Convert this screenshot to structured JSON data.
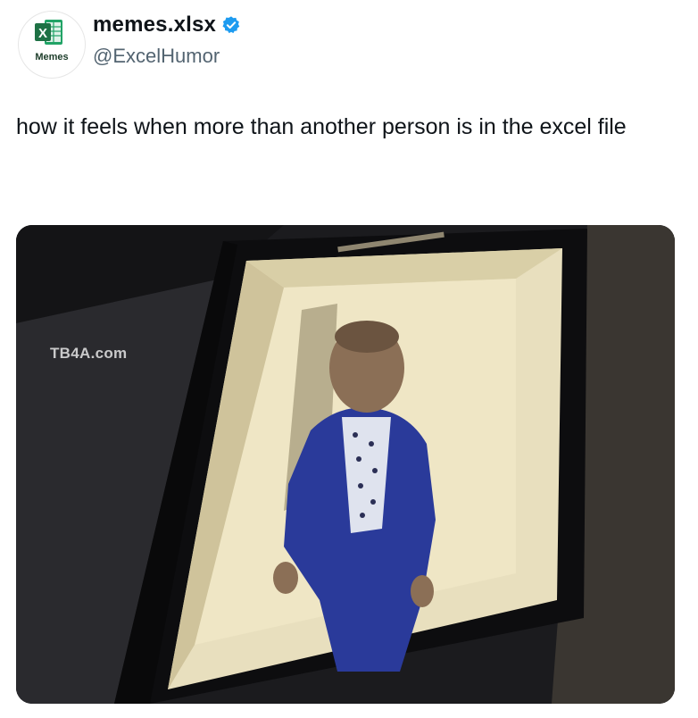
{
  "author": {
    "display_name": "memes.xlsx",
    "handle": "@ExcelHumor",
    "avatar_label": "Memes",
    "logo_letter": "X",
    "verified": true
  },
  "post": {
    "text": "how it feels when more than another person is in the excel file"
  },
  "media": {
    "watermark": "TB4A.com",
    "description_icon": "photo"
  },
  "colors": {
    "excel_green": "#1e7145",
    "verified_blue": "#1d9bf0",
    "handle_gray": "#536471"
  }
}
